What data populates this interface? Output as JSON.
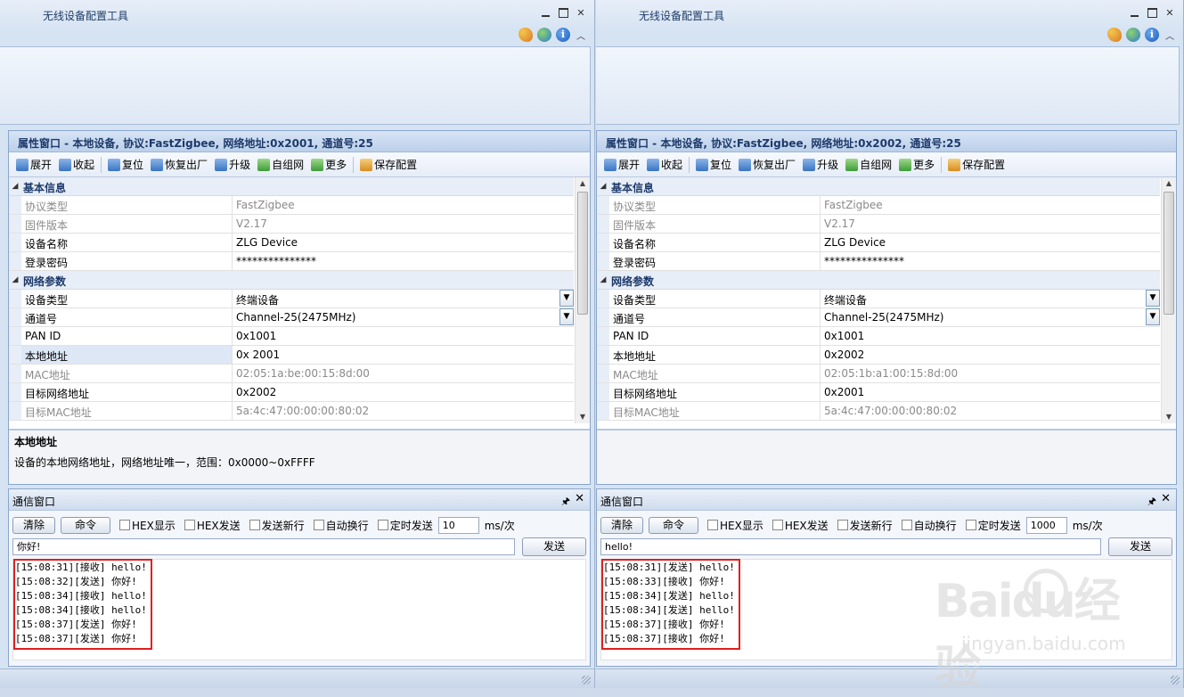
{
  "windows": [
    {
      "id": "left",
      "title": "无线设备配置工具",
      "prop_header": "属性窗口 - 本地设备, 协议:FastZigbee, 网络地址:0x2001, 通道号:25",
      "toolbar": [
        "展开",
        "收起",
        "复位",
        "恢复出厂",
        "升级",
        "自组网",
        "更多",
        "保存配置"
      ],
      "basic": {
        "cat": "基本信息",
        "rows": [
          {
            "k": "协议类型",
            "v": "FastZigbee",
            "dis": true
          },
          {
            "k": "固件版本",
            "v": "V2.17",
            "dis": true
          },
          {
            "k": "设备名称",
            "v": "ZLG Device"
          },
          {
            "k": "登录密码",
            "v": "***************"
          }
        ]
      },
      "net": {
        "cat": "网络参数",
        "rows": [
          {
            "k": "设备类型",
            "v": "终端设备",
            "dd": true
          },
          {
            "k": "通道号",
            "v": "Channel-25(2475MHz)",
            "dd": true
          },
          {
            "k": "PAN ID",
            "v": "0x1001"
          },
          {
            "k": "本地地址",
            "v": "0x 2001",
            "sel": true
          },
          {
            "k": "MAC地址",
            "v": "02:05:1a:be:00:15:8d:00",
            "dis": true
          },
          {
            "k": "目标网络地址",
            "v": "0x2002"
          },
          {
            "k": "目标MAC地址",
            "v": "5a:4c:47:00:00:00:80:02",
            "dis": true
          }
        ]
      },
      "desc_title": "本地地址",
      "desc_text": "设备的本地网络地址，网络地址唯一，范围：0x0000~0xFFFF",
      "comm": {
        "title": "通信窗口",
        "clear": "清除",
        "cmd": "命令",
        "checks": [
          "HEX显示",
          "HEX发送",
          "发送新行",
          "自动换行",
          "定时发送"
        ],
        "interval": "10",
        "unit": "ms/次",
        "input": "你好!",
        "send": "发送",
        "log": [
          "[15:08:31][接收] hello!",
          "[15:08:32][发送] 你好!",
          "[15:08:34][接收] hello!",
          "[15:08:34][接收] hello!",
          "[15:08:37][发送] 你好!",
          "[15:08:37][发送] 你好!"
        ]
      }
    },
    {
      "id": "right",
      "title": "无线设备配置工具",
      "prop_header": "属性窗口 - 本地设备, 协议:FastZigbee, 网络地址:0x2002, 通道号:25",
      "toolbar": [
        "展开",
        "收起",
        "复位",
        "恢复出厂",
        "升级",
        "自组网",
        "更多",
        "保存配置"
      ],
      "basic": {
        "cat": "基本信息",
        "rows": [
          {
            "k": "协议类型",
            "v": "FastZigbee",
            "dis": true
          },
          {
            "k": "固件版本",
            "v": "V2.17",
            "dis": true
          },
          {
            "k": "设备名称",
            "v": "ZLG Device"
          },
          {
            "k": "登录密码",
            "v": "***************"
          }
        ]
      },
      "net": {
        "cat": "网络参数",
        "rows": [
          {
            "k": "设备类型",
            "v": "终端设备",
            "dd": true
          },
          {
            "k": "通道号",
            "v": "Channel-25(2475MHz)",
            "dd": true
          },
          {
            "k": "PAN ID",
            "v": "0x1001"
          },
          {
            "k": "本地地址",
            "v": "0x2002"
          },
          {
            "k": "MAC地址",
            "v": "02:05:1b:a1:00:15:8d:00",
            "dis": true
          },
          {
            "k": "目标网络地址",
            "v": "0x2001"
          },
          {
            "k": "目标MAC地址",
            "v": "5a:4c:47:00:00:00:80:02",
            "dis": true
          }
        ]
      },
      "desc_title": "",
      "desc_text": "",
      "comm": {
        "title": "通信窗口",
        "clear": "清除",
        "cmd": "命令",
        "checks": [
          "HEX显示",
          "HEX发送",
          "发送新行",
          "自动换行",
          "定时发送"
        ],
        "interval": "1000",
        "unit": "ms/次",
        "input": "hello!",
        "send": "发送",
        "log": [
          "[15:08:31][发送] hello!",
          "[15:08:33][接收] 你好!",
          "[15:08:34][发送] hello!",
          "[15:08:34][发送] hello!",
          "[15:08:37][接收] 你好!",
          "[15:08:37][接收] 你好!"
        ]
      }
    }
  ],
  "watermark": {
    "brand": "Baidu经验",
    "url": "jingyan.baidu.com"
  },
  "icons": [
    "palette-icon",
    "globe-icon",
    "info-icon"
  ],
  "colors": {
    "header_text": "#1d3a6b",
    "highlight_box": "#e02020"
  }
}
